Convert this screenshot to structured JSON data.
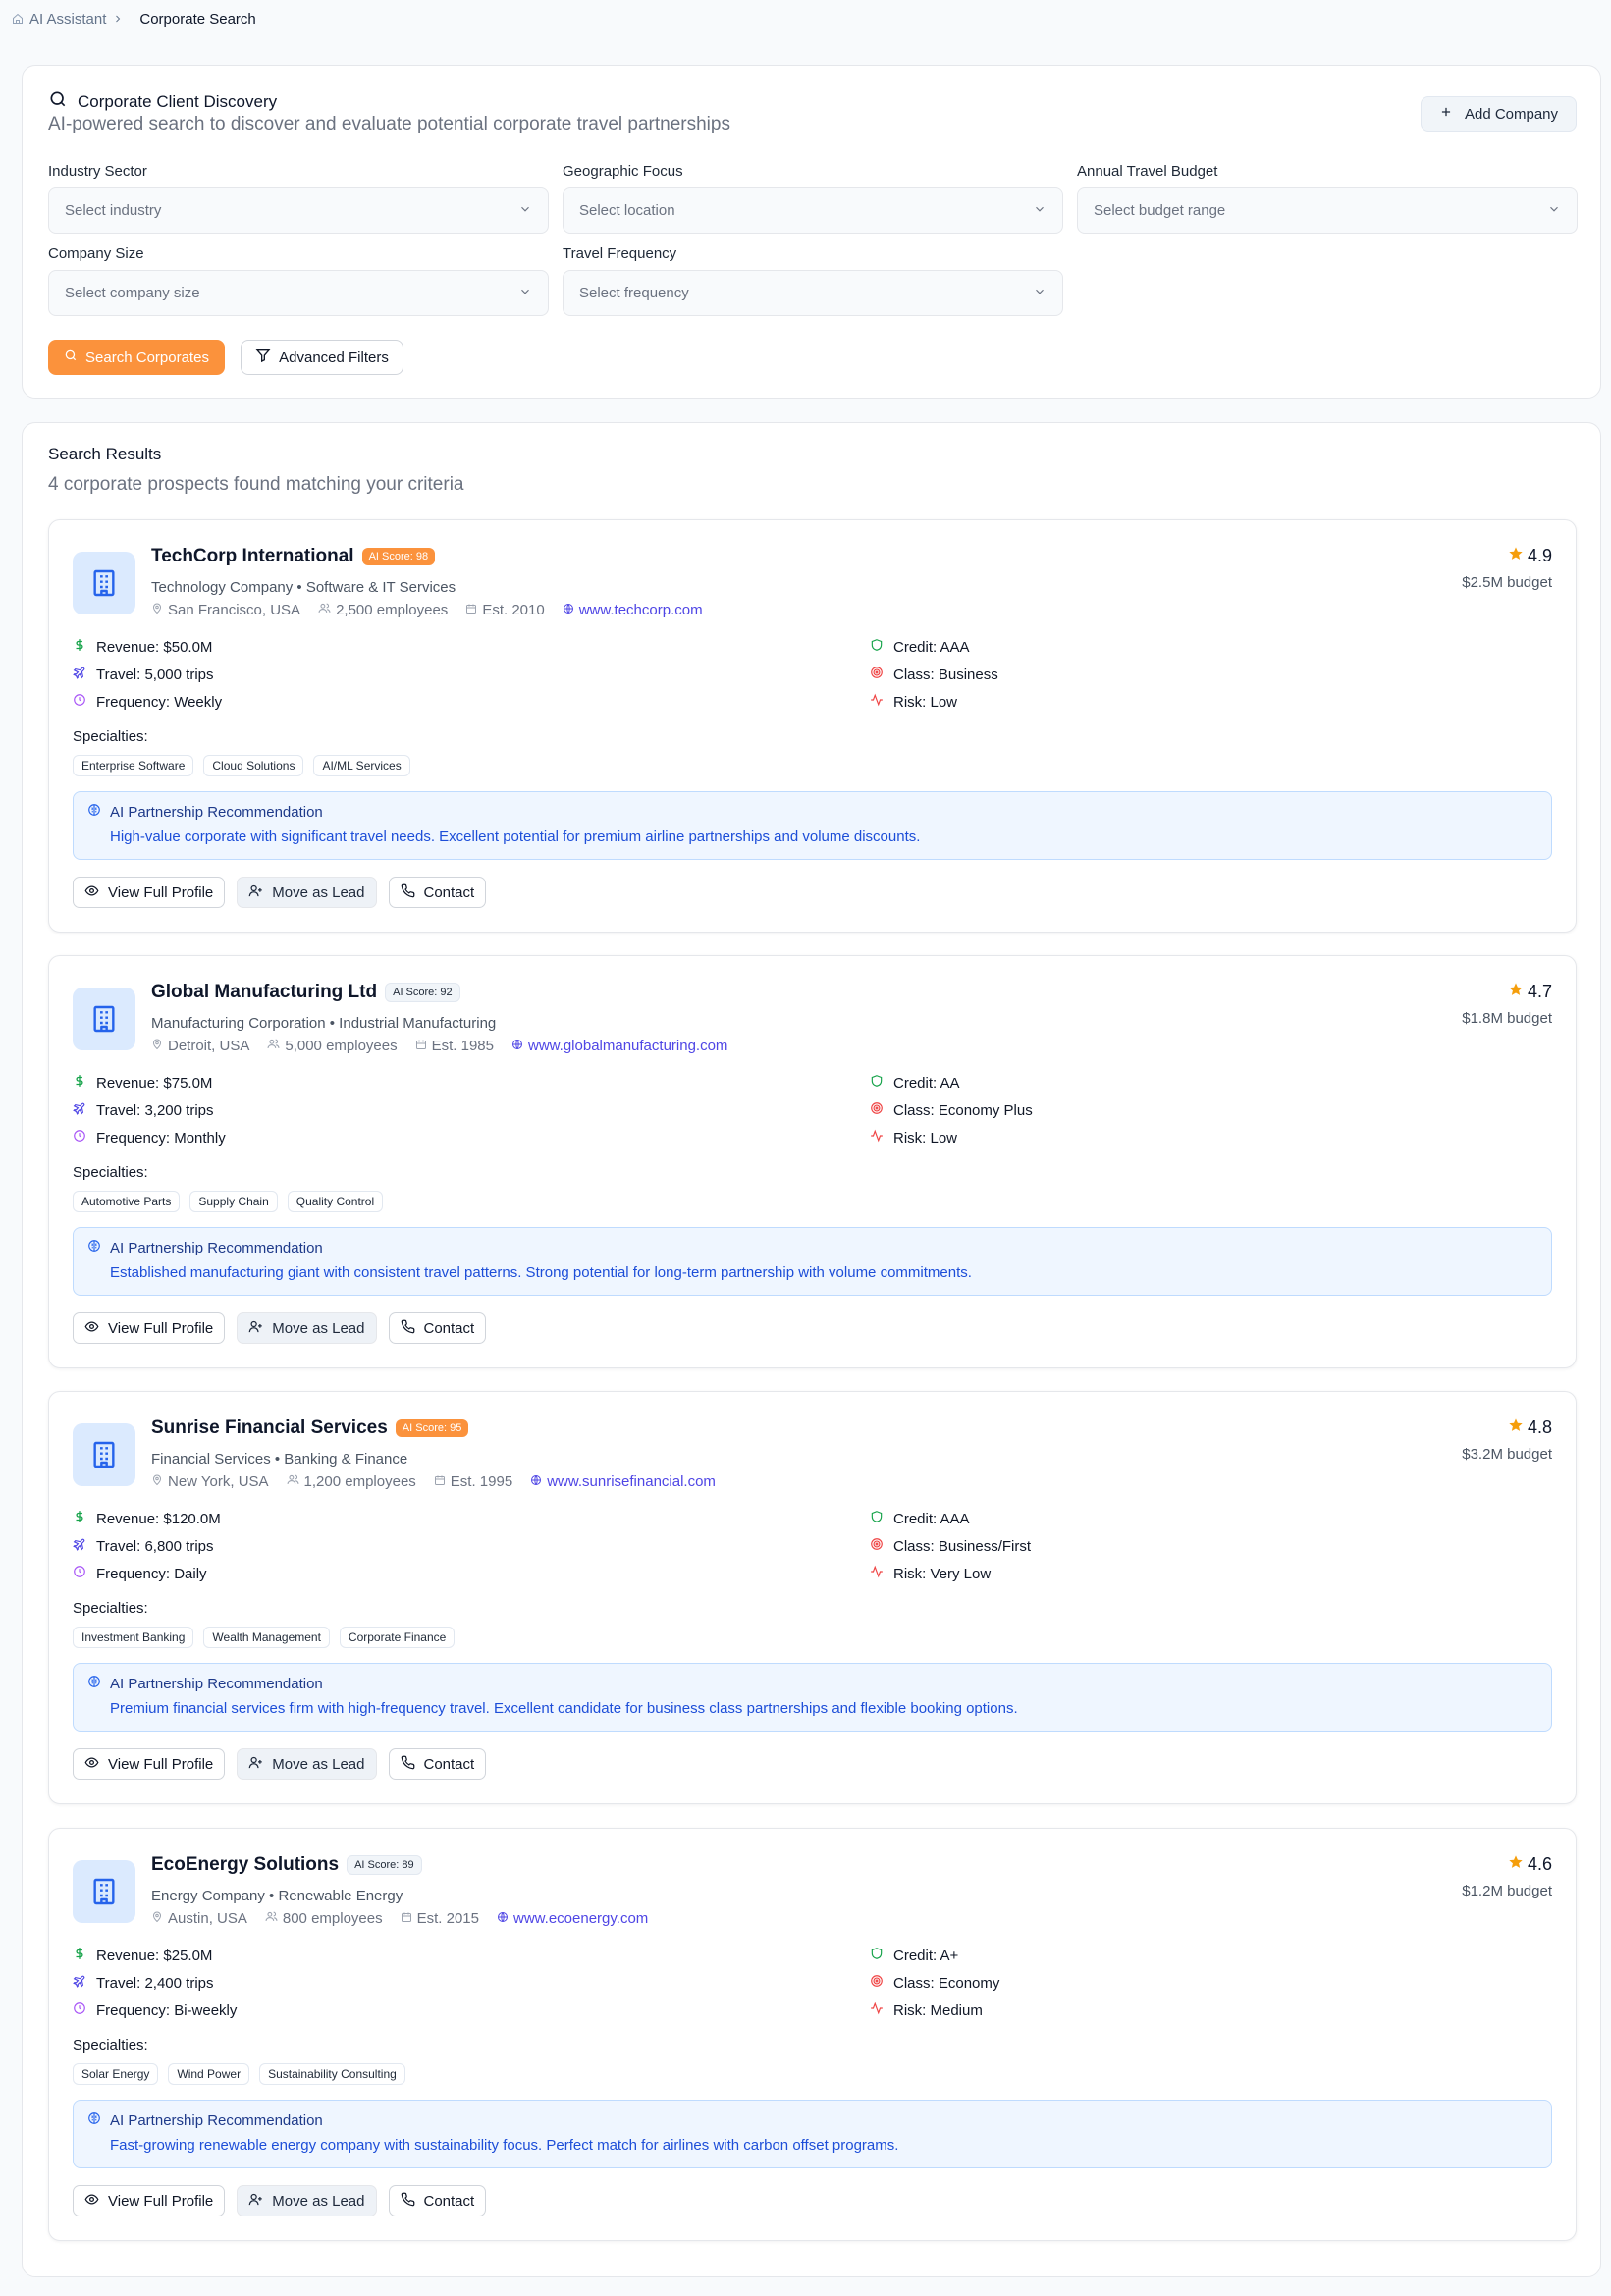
{
  "breadcrumb": {
    "parent": "AI Assistant",
    "current": "Corporate Search"
  },
  "search": {
    "title": "Corporate Client Discovery",
    "subtitle": "AI-powered search to discover and evaluate potential corporate travel partnerships",
    "add_company_label": "Add Company",
    "filters": {
      "industry": {
        "label": "Industry Sector",
        "placeholder": "Select industry"
      },
      "geo": {
        "label": "Geographic Focus",
        "placeholder": "Select location"
      },
      "budget": {
        "label": "Annual Travel Budget",
        "placeholder": "Select budget range"
      },
      "size": {
        "label": "Company Size",
        "placeholder": "Select company size"
      },
      "frequency": {
        "label": "Travel Frequency",
        "placeholder": "Select frequency"
      }
    },
    "search_button": "Search Corporates",
    "advanced_button": "Advanced Filters"
  },
  "results": {
    "title": "Search Results",
    "subtitle": "4 corporate prospects found matching your criteria",
    "specialties_label": "Specialties:",
    "reco_title": "AI Partnership Recommendation",
    "actions": {
      "view": "View Full Profile",
      "lead": "Move as Lead",
      "contact": "Contact"
    },
    "colors": {
      "accent": "#fb923c",
      "link": "#4f46e5",
      "star": "#f59e0b"
    },
    "companies": [
      {
        "name": "TechCorp International",
        "score": "AI Score: 98",
        "type": "Technology Company • Software & IT Services",
        "location": "San Francisco, USA",
        "employees": "2,500 employees",
        "est": "Est. 2010",
        "website": "www.techcorp.com",
        "rating": "4.9",
        "budget": "$2.5M budget",
        "revenue": "Revenue: $50.0M",
        "travel": "Travel: 5,000 trips",
        "frequency": "Frequency: Weekly",
        "credit": "Credit: AAA",
        "class": "Class: Business",
        "risk": "Risk: Low",
        "specialties": [
          "Enterprise Software",
          "Cloud Solutions",
          "AI/ML Services"
        ],
        "reco": "High-value corporate with significant travel needs. Excellent potential for premium airline partnerships and volume discounts."
      },
      {
        "name": "Global Manufacturing Ltd",
        "score": "AI Score: 92",
        "type": "Manufacturing Corporation • Industrial Manufacturing",
        "location": "Detroit, USA",
        "employees": "5,000 employees",
        "est": "Est. 1985",
        "website": "www.globalmanufacturing.com",
        "rating": "4.7",
        "budget": "$1.8M budget",
        "revenue": "Revenue: $75.0M",
        "travel": "Travel: 3,200 trips",
        "frequency": "Frequency: Monthly",
        "credit": "Credit: AA",
        "class": "Class: Economy Plus",
        "risk": "Risk: Low",
        "specialties": [
          "Automotive Parts",
          "Supply Chain",
          "Quality Control"
        ],
        "reco": "Established manufacturing giant with consistent travel patterns. Strong potential for long-term partnership with volume commitments."
      },
      {
        "name": "Sunrise Financial Services",
        "score": "AI Score: 95",
        "type": "Financial Services • Banking & Finance",
        "location": "New York, USA",
        "employees": "1,200 employees",
        "est": "Est. 1995",
        "website": "www.sunrisefinancial.com",
        "rating": "4.8",
        "budget": "$3.2M budget",
        "revenue": "Revenue: $120.0M",
        "travel": "Travel: 6,800 trips",
        "frequency": "Frequency: Daily",
        "credit": "Credit: AAA",
        "class": "Class: Business/First",
        "risk": "Risk: Very Low",
        "specialties": [
          "Investment Banking",
          "Wealth Management",
          "Corporate Finance"
        ],
        "reco": "Premium financial services firm with high-frequency travel. Excellent candidate for business class partnerships and flexible booking options."
      },
      {
        "name": "EcoEnergy Solutions",
        "score": "AI Score: 89",
        "type": "Energy Company • Renewable Energy",
        "location": "Austin, USA",
        "employees": "800 employees",
        "est": "Est. 2015",
        "website": "www.ecoenergy.com",
        "rating": "4.6",
        "budget": "$1.2M budget",
        "revenue": "Revenue: $25.0M",
        "travel": "Travel: 2,400 trips",
        "frequency": "Frequency: Bi-weekly",
        "credit": "Credit: A+",
        "class": "Class: Economy",
        "risk": "Risk: Medium",
        "specialties": [
          "Solar Energy",
          "Wind Power",
          "Sustainability Consulting"
        ],
        "reco": "Fast-growing renewable energy company with sustainability focus. Perfect match for airlines with carbon offset programs."
      }
    ]
  }
}
